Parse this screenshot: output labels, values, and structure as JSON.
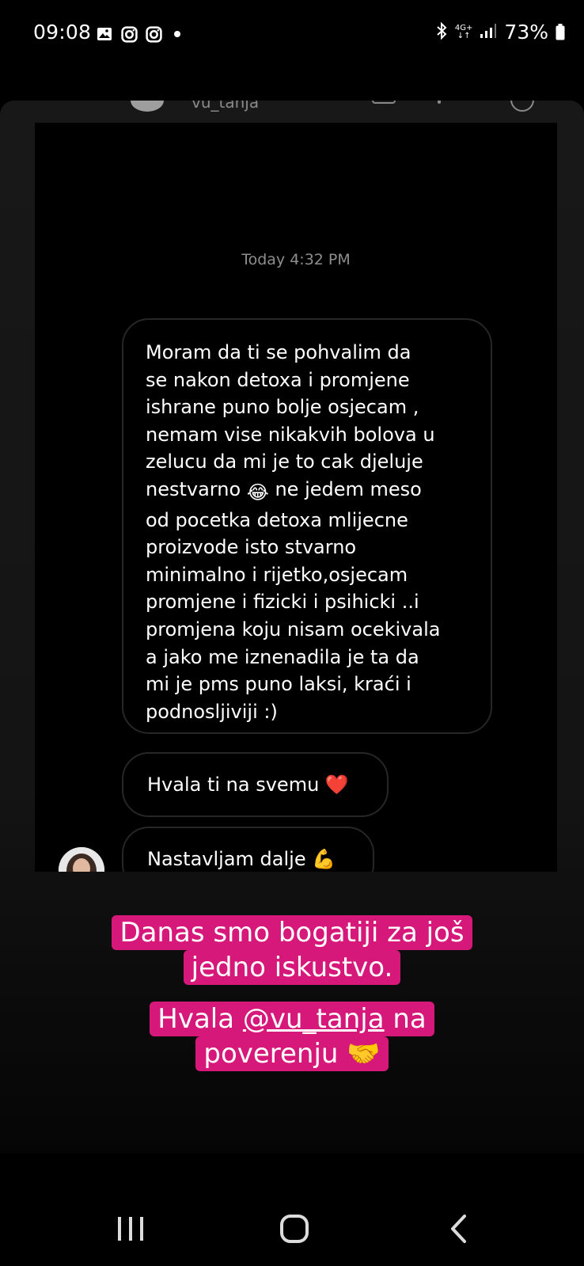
{
  "status_bar": {
    "time": "09:08",
    "network": "4G+",
    "battery": "73%"
  },
  "story_header": {
    "username": "vu_tanja"
  },
  "chat": {
    "timestamp": "Today 4:32 PM",
    "messages": [
      {
        "lines": [
          "Moram da ti se pohvalim da",
          "se nakon detoxa i promjene",
          "ishrane puno bolje osjecam ,",
          "nemam vise nikakvih bolova u",
          "zelucu da mi je to cak djeluje",
          "nestvarno",
          "ne jedem meso",
          "od pocetka detoxa  mlijecne",
          "proizvode isto stvarno",
          "minimalno i rijetko,osjecam",
          "promjene i fizicki i psihicki ..i",
          "promjena koju nisam ocekivala",
          "a jako me iznenadila je ta da",
          "mi je pms puno laksi,  kraći  i",
          "podnosljiviji :)"
        ],
        "emoji": "😂"
      },
      {
        "text": "Hvala ti na svemu",
        "emoji": "❤️"
      },
      {
        "text": "Nastavljam dalje",
        "emoji": "💪"
      }
    ]
  },
  "captions": {
    "line1": "Danas smo bogatiji za još",
    "line2": "jedno iskustvo.",
    "line3_pre": "Hvala ",
    "line3_mention": "@vu_tanja",
    "line3_post": " na",
    "line4": "poverenju",
    "line4_emoji": "🤝"
  },
  "colors": {
    "caption_bg": "#d6187a",
    "bubble_border": "#262626",
    "timestamp": "#8e8e8e"
  }
}
